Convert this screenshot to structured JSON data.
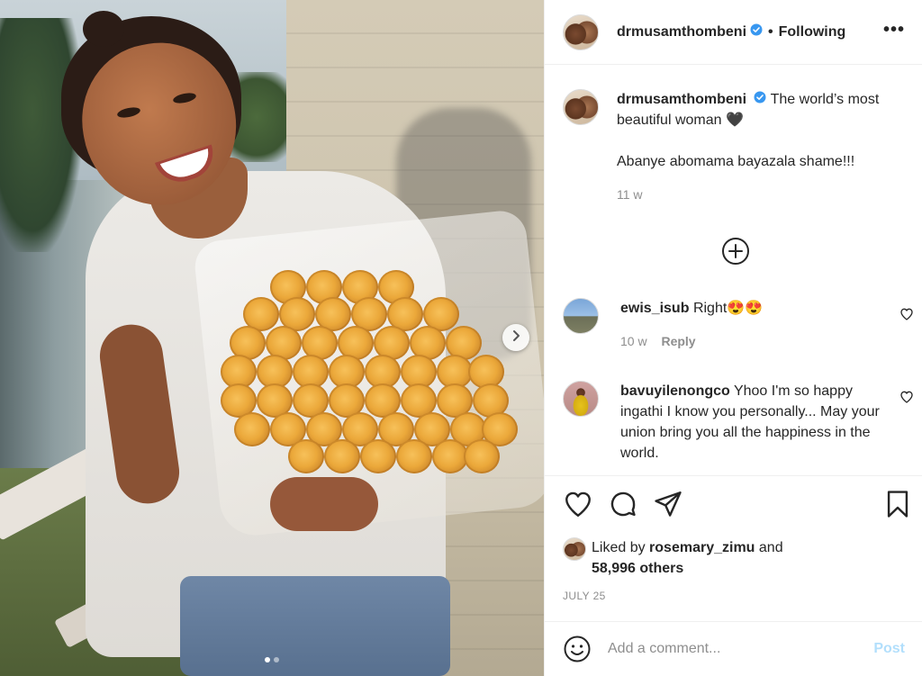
{
  "post": {
    "author": "drmusamthombeni",
    "follow_state": "Following",
    "separator": "•",
    "more": "•••"
  },
  "caption": {
    "username": "drmusamthombeni",
    "text_line1": "The world’s most beautiful woman 🖤",
    "text_line2": "Abanye abomama bayazala shame!!!",
    "time": "11 w"
  },
  "comments": [
    {
      "username": "ewis_isub",
      "text": "Right😍😍",
      "time": "10 w",
      "reply_label": "Reply"
    },
    {
      "username": "bavuyilenongco",
      "text": "Yhoo I'm so happy ingathi I know you personally... May your union bring you all the happiness in the world."
    }
  ],
  "likes": {
    "prefix": "Liked by",
    "user": "rosemary_zimu",
    "connector": "and",
    "others": "58,996 others"
  },
  "date": "JULY 25",
  "add_comment": {
    "placeholder": "Add a comment...",
    "post_label": "Post"
  },
  "carousel": {
    "current": 1,
    "total": 2
  },
  "colors": {
    "verified": "#3897f0",
    "post_disabled": "#b2dffc",
    "muted": "#8e8e8e"
  },
  "icons": [
    "heart-icon",
    "comment-icon",
    "share-icon",
    "bookmark-icon",
    "plus-circle-icon",
    "emoji-icon",
    "chevron-right-icon",
    "more-icon",
    "verified-icon"
  ]
}
